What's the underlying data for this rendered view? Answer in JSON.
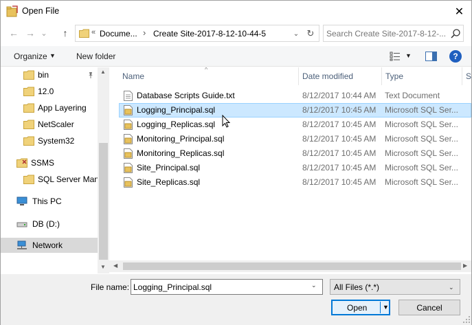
{
  "window": {
    "title": "Open File",
    "close_glyph": "✕"
  },
  "nav": {
    "back_glyph": "←",
    "forward_glyph": "→",
    "recent_glyph": "⌄",
    "up_glyph": "↑",
    "address": {
      "overflow": "«",
      "crumb1": "Docume...",
      "crumb2": "Create Site-2017-8-12-10-44-5",
      "separator": "›",
      "dropdown_glyph": "⌄",
      "refresh_glyph": "↻"
    },
    "search_placeholder": "Search Create Site-2017-8-12-..."
  },
  "toolbar": {
    "organize_label": "Organize",
    "organize_arrow": "▼",
    "new_folder_label": "New folder",
    "view_arrow": "▼",
    "help_glyph": "?"
  },
  "navpane": {
    "items": [
      {
        "label": "bin",
        "icon": "folder-icon",
        "pinned": true
      },
      {
        "label": "12.0",
        "icon": "folder-icon"
      },
      {
        "label": "App Layering",
        "icon": "folder-icon"
      },
      {
        "label": "NetScaler",
        "icon": "folder-icon"
      },
      {
        "label": "System32",
        "icon": "folder-icon"
      },
      {
        "label": "SSMS",
        "icon": "ssms-icon"
      },
      {
        "label": "SQL Server Mana",
        "icon": "folder-icon"
      },
      {
        "label": "This PC",
        "icon": "computer-icon"
      },
      {
        "label": "DB (D:)",
        "icon": "drive-icon"
      },
      {
        "label": "Network",
        "icon": "network-icon",
        "selected": true
      }
    ],
    "scroll_up": "▲",
    "scroll_down": "▼"
  },
  "filelist": {
    "columns": {
      "name": "Name",
      "date": "Date modified",
      "type": "Type",
      "size": "S"
    },
    "sort_glyph": "^",
    "rows": [
      {
        "name": "Database Scripts Guide.txt",
        "date": "8/12/2017 10:44 AM",
        "type": "Text Document",
        "icon": "text-file-icon"
      },
      {
        "name": "Logging_Principal.sql",
        "date": "8/12/2017 10:45 AM",
        "type": "Microsoft SQL Ser...",
        "icon": "sql-file-icon",
        "selected": true
      },
      {
        "name": "Logging_Replicas.sql",
        "date": "8/12/2017 10:45 AM",
        "type": "Microsoft SQL Ser...",
        "icon": "sql-file-icon"
      },
      {
        "name": "Monitoring_Principal.sql",
        "date": "8/12/2017 10:45 AM",
        "type": "Microsoft SQL Ser...",
        "icon": "sql-file-icon"
      },
      {
        "name": "Monitoring_Replicas.sql",
        "date": "8/12/2017 10:45 AM",
        "type": "Microsoft SQL Ser...",
        "icon": "sql-file-icon"
      },
      {
        "name": "Site_Principal.sql",
        "date": "8/12/2017 10:45 AM",
        "type": "Microsoft SQL Ser...",
        "icon": "sql-file-icon"
      },
      {
        "name": "Site_Replicas.sql",
        "date": "8/12/2017 10:45 AM",
        "type": "Microsoft SQL Ser...",
        "icon": "sql-file-icon"
      }
    ],
    "scroll_left": "◀",
    "scroll_right": "▶"
  },
  "footer": {
    "filename_label": "File name:",
    "filename_value": "Logging_Principal.sql",
    "filename_drop": "⌄",
    "filter_value": "All Files (*.*)",
    "filter_drop": "⌄",
    "open_label": "Open",
    "open_drop": "▼",
    "cancel_label": "Cancel"
  },
  "colors": {
    "accent": "#0078d7",
    "selection_bg": "#cce8ff",
    "selection_border": "#99d1ff",
    "folder": "#e8c25d",
    "header_text": "#4c607a"
  }
}
